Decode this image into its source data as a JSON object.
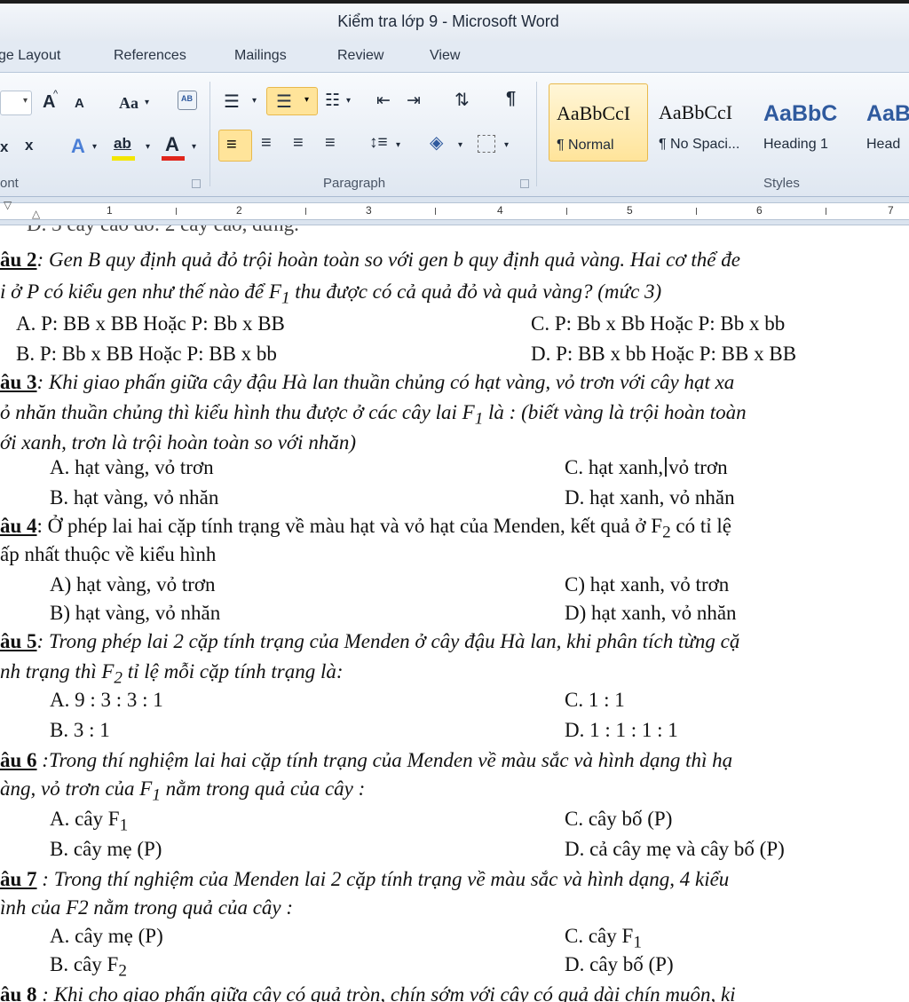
{
  "window": {
    "title": "Kiểm tra lớp 9  -  Microsoft Word"
  },
  "tabs": [
    "ge Layout",
    "References",
    "Mailings",
    "Review",
    "View"
  ],
  "ribbon": {
    "font_group_label": "ont",
    "paragraph_group_label": "Paragraph",
    "styles_group_label": "Styles",
    "font_buttons": {
      "grow": "A",
      "shrink": "A",
      "change_case": "Aa",
      "subscript": "x",
      "superscript": "x",
      "font_color": "A",
      "highlight": "ab"
    },
    "styles": [
      {
        "sample": "AaBbCcI",
        "name": "¶ Normal"
      },
      {
        "sample": "AaBbCcI",
        "name": "¶ No Spaci..."
      },
      {
        "sample": "AaBbC",
        "name": "Heading 1"
      },
      {
        "sample": "AaB",
        "name": "Head"
      }
    ],
    "colors": {
      "accent_selected": "#ffe49a",
      "font_color_bar": "#e0251b",
      "highlight_bar": "#f3e600",
      "heading_blue": "#2f5a9e"
    }
  },
  "ruler": {
    "numbers": [
      "1",
      "2",
      "3",
      "4",
      "5",
      "6",
      "7"
    ]
  },
  "document": {
    "partial_top": "D. 3 cây cao đỏ: 2 cây cao, dứng.",
    "q2": {
      "label": "âu 2",
      "text1": ": Gen B quy định quả đỏ trội hoàn toàn so với gen b quy định quả vàng. Hai cơ thể đe",
      "text2a": "i ở P có kiểu gen  như thế nào để F",
      "text2b": " thu được có cả quả đỏ và quả vàng? (mức 3)",
      "A": "A. P: BB x BB  Hoặc  P: Bb x BB",
      "C": "C. P: Bb x Bb   Hoặc  P: Bb x bb",
      "B": "B. P: Bb x BB  Hoặc  P: BB x bb",
      "D": "D. P: BB x bb   Hoặc  P: BB x BB"
    },
    "q3": {
      "label": "âu 3",
      "text1": ": Khi giao phấn giữa cây đậu Hà lan thuần chủng có hạt vàng, vỏ trơn với cây hạt xa",
      "text2a": "ỏ nhăn thuần chủng thì kiểu hình thu được ở các cây lai F",
      "text2b": " là : (biết vàng là trội hoàn toàn",
      "text3": "ới xanh, trơn là trội hoàn toàn so với nhăn)",
      "A": "A. hạt vàng, vỏ trơn",
      "C_pre": "C. hạt xanh,",
      "C_post": "vỏ trơn",
      "B": "B. hạt vàng, vỏ nhăn",
      "D": "D. hạt xanh, vỏ nhăn"
    },
    "q4": {
      "label": "âu 4",
      "text1a": ": Ở phép lai hai cặp tính trạng về màu hạt và vỏ hạt của Menden, kết quả ở F",
      "text1b": " có tỉ lệ",
      "text2": "ấp nhất thuộc về kiểu hình",
      "A": "A) hạt vàng, vỏ trơn",
      "C": "C) hạt xanh, vỏ trơn",
      "B": "B) hạt vàng, vỏ nhăn",
      "D": "D) hạt xanh, vỏ nhăn"
    },
    "q5": {
      "label": "âu 5",
      "text1": ": Trong phép lai 2 cặp tính trạng của Menden ở cây đậu Hà lan, khi phân tích từng cặ",
      "text2a": "nh trạng thì F",
      "text2b": " tỉ lệ mỗi cặp tính trạng là:",
      "A": "A. 9 : 3 : 3 : 1",
      "C": "C. 1 : 1",
      "B": "B. 3 : 1",
      "D": "D. 1 : 1 : 1 : 1"
    },
    "q6": {
      "label": "âu 6",
      "text1": " :Trong thí nghiệm lai hai cặp tính trạng của Menden về màu sắc và hình dạng thì hạ",
      "text2a": "àng, vỏ trơn của F",
      "text2b": " nằm trong quả của cây :",
      "A": "A. cây F",
      "C": "C. cây bố (P)",
      "B": "B. cây mẹ (P)",
      "D": "D. cả cây mẹ và cây bố (P)"
    },
    "q7": {
      "label": "âu 7",
      "text1": " : Trong thí nghiệm của Menden lai 2 cặp tính trạng về màu sắc và hình dạng, 4 kiểu",
      "text2": "ình của F2 nằm trong quả của cây :",
      "A": "A. cây mẹ (P)",
      "C": "C. cây F",
      "B": "B. cây F",
      "D": "D. cây bố (P)"
    },
    "q8": {
      "label": "âu 8",
      "text1": " : Khi cho giao phấn giữa cây có quả tròn, chín sớm với cây có quả dài chín muộn, ki"
    },
    "sub1": "1",
    "sub2": "2"
  }
}
